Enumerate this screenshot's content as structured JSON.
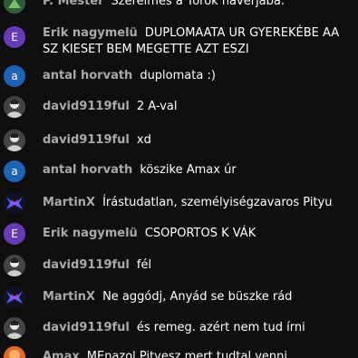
{
  "chat": {
    "messages": [
      {
        "author": "P. Mester",
        "text": "Szerelmes a Török haverjába.",
        "avatar_letter": ""
      },
      {
        "author": "Erik nagymelü",
        "text": "DUPLOMAATA UR GYEREKÉBE AA SZ KIESET BEM MEGETTE AZT ESZI",
        "avatar_letter": "E"
      },
      {
        "author": "antal horvath",
        "text": "duplomata :)",
        "avatar_letter": "a"
      },
      {
        "author": "david9119ful",
        "text": "2 A-val",
        "avatar_letter": ""
      },
      {
        "author": "david9119ful",
        "text": "xd",
        "avatar_letter": ""
      },
      {
        "author": "antal horvath",
        "text": "köszike Amax úr",
        "avatar_letter": "a"
      },
      {
        "author": "MartinX",
        "text": "Írástudatlan, személyiségzavaros Pityu",
        "avatar_letter": ""
      },
      {
        "author": "Erik nagymelü",
        "text": "CSOPORTOS K VÁK",
        "avatar_letter": "E"
      },
      {
        "author": "david9119ful",
        "text": "fél",
        "avatar_letter": ""
      },
      {
        "author": "MartinX",
        "text": "Ne aggódj, Anyád se büszke rád",
        "avatar_letter": ""
      },
      {
        "author": "david9119ful",
        "text": "és remeg. azért nem tud írni",
        "avatar_letter": ""
      },
      {
        "author": "Amax",
        "text": "MEnazol Pityesz mert tudtal venni",
        "avatar_letter": ""
      }
    ]
  },
  "colors": {
    "background": "#0f0f0f",
    "author": "#aaaaaa",
    "message": "#ffffff",
    "avatar_e": "#673ab7",
    "avatar_a": "#1e63b5"
  }
}
